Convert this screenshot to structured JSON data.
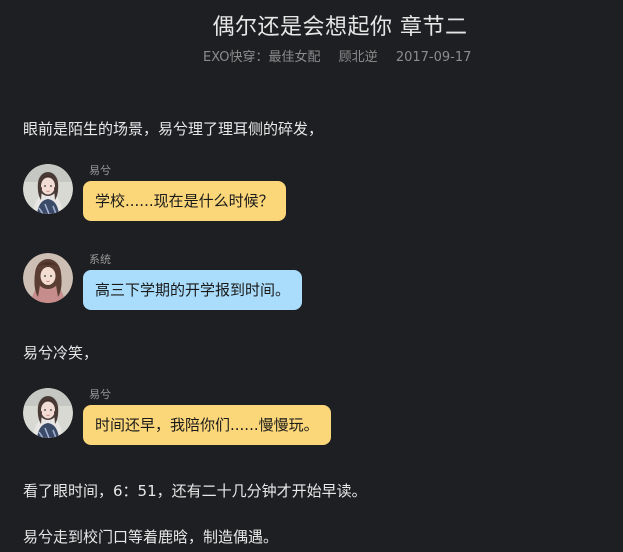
{
  "header": {
    "title": "偶尔还是会想起你 章节二",
    "category": "EXO快穿：最佳女配",
    "author": "顾北逆",
    "date": "2017-09-17"
  },
  "content": {
    "para1": "眼前是陌生的场景，易兮理了理耳侧的碎发，",
    "para2": "易兮冷笑，",
    "para3": "看了眼时间，6：51，还有二十几分钟才开始早读。",
    "para4": "易兮走到校门口等着鹿晗，制造偶遇。"
  },
  "messages": [
    {
      "speaker": "易兮",
      "text": "学校......现在是什么时候？",
      "bubble_color": "#fbd77a"
    },
    {
      "speaker": "系统",
      "text": "高三下学期的开学报到时间。",
      "bubble_color": "#a9ddfb"
    },
    {
      "speaker": "易兮",
      "text": "时间还早，我陪你们......慢慢玩。",
      "bubble_color": "#fbd77a"
    }
  ]
}
